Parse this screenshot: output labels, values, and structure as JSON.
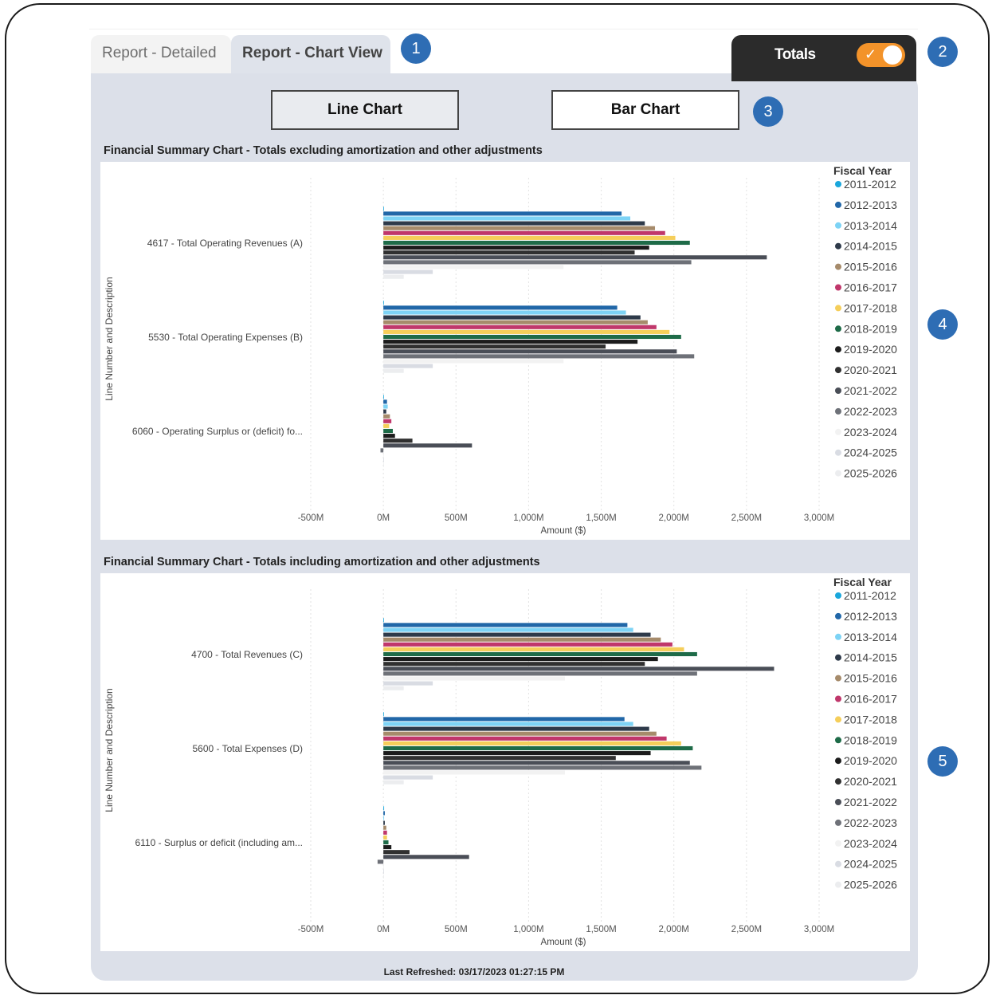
{
  "tabs": [
    {
      "label": "Report - Detailed"
    },
    {
      "label": "Report - Chart View"
    }
  ],
  "totals": {
    "label": "Totals",
    "toggle_on": true,
    "toggle_color": "#F3932A"
  },
  "view_buttons": {
    "line": "Line Chart",
    "bar": "Bar Chart"
  },
  "markers": [
    "1",
    "2",
    "3",
    "4",
    "5"
  ],
  "footer": {
    "last_refreshed": "Last Refreshed: 03/17/2023 01:27:15 PM"
  },
  "chart_data": [
    {
      "type": "bar",
      "orientation": "horizontal",
      "title": "Financial Summary Chart - Totals excluding amortization and other adjustments",
      "xlabel": "Amount ($)",
      "ylabel": "Line Number and Description",
      "xlim": [
        -500,
        3000
      ],
      "xticks": [
        "-500M",
        "0M",
        "500M",
        "1,000M",
        "1,500M",
        "2,000M",
        "2,500M",
        "3,000M"
      ],
      "legend_title": "Fiscal Year",
      "legend_position": "right",
      "categories": [
        "4617 - Total Operating Revenues (A)",
        "5530 - Total Operating Expenses (B)",
        "6060 - Operating Surplus or (deficit) fo..."
      ],
      "series": [
        {
          "name": "2011-2012",
          "color": "#1AA7DC",
          "values": [
            1,
            1,
            1
          ]
        },
        {
          "name": "2012-2013",
          "color": "#2167A8",
          "values": [
            1640,
            1610,
            25
          ]
        },
        {
          "name": "2013-2014",
          "color": "#7DD3F5",
          "values": [
            1700,
            1670,
            30
          ]
        },
        {
          "name": "2014-2015",
          "color": "#2E3A4A",
          "values": [
            1800,
            1770,
            20
          ]
        },
        {
          "name": "2015-2016",
          "color": "#A68B6B",
          "values": [
            1870,
            1820,
            45
          ]
        },
        {
          "name": "2016-2017",
          "color": "#C0376B",
          "values": [
            1940,
            1880,
            55
          ]
        },
        {
          "name": "2017-2018",
          "color": "#F5CE5A",
          "values": [
            2010,
            1970,
            40
          ]
        },
        {
          "name": "2018-2019",
          "color": "#1E6B48",
          "values": [
            2110,
            2050,
            65
          ]
        },
        {
          "name": "2019-2020",
          "color": "#1C1C1C",
          "values": [
            1830,
            1750,
            80
          ]
        },
        {
          "name": "2020-2021",
          "color": "#303030",
          "values": [
            1730,
            1530,
            200
          ]
        },
        {
          "name": "2021-2022",
          "color": "#4A4E57",
          "values": [
            2640,
            2020,
            610
          ]
        },
        {
          "name": "2022-2023",
          "color": "#6E7178",
          "values": [
            2120,
            2140,
            -20
          ]
        },
        {
          "name": "2023-2024",
          "color": "#F2F2F2",
          "values": [
            1240,
            1240,
            0
          ]
        },
        {
          "name": "2024-2025",
          "color": "#D9DCE3",
          "values": [
            340,
            340,
            0
          ]
        },
        {
          "name": "2025-2026",
          "color": "#ECEDEF",
          "values": [
            140,
            140,
            0
          ]
        }
      ]
    },
    {
      "type": "bar",
      "orientation": "horizontal",
      "title": "Financial Summary Chart - Totals including amortization and other adjustments",
      "xlabel": "Amount ($)",
      "ylabel": "Line Number and Description",
      "xlim": [
        -500,
        3000
      ],
      "xticks": [
        "-500M",
        "0M",
        "500M",
        "1,000M",
        "1,500M",
        "2,000M",
        "2,500M",
        "3,000M"
      ],
      "legend_title": "Fiscal Year",
      "legend_position": "right",
      "categories": [
        "4700 - Total Revenues (C)",
        "5600 - Total Expenses (D)",
        "6110 - Surplus or deficit (including am..."
      ],
      "series": [
        {
          "name": "2011-2012",
          "color": "#1AA7DC",
          "values": [
            1,
            1,
            5
          ]
        },
        {
          "name": "2012-2013",
          "color": "#2167A8",
          "values": [
            1680,
            1660,
            10
          ]
        },
        {
          "name": "2013-2014",
          "color": "#7DD3F5",
          "values": [
            1720,
            1720,
            5
          ]
        },
        {
          "name": "2014-2015",
          "color": "#2E3A4A",
          "values": [
            1840,
            1830,
            10
          ]
        },
        {
          "name": "2015-2016",
          "color": "#A68B6B",
          "values": [
            1910,
            1880,
            20
          ]
        },
        {
          "name": "2016-2017",
          "color": "#C0376B",
          "values": [
            1990,
            1950,
            25
          ]
        },
        {
          "name": "2017-2018",
          "color": "#F5CE5A",
          "values": [
            2070,
            2050,
            25
          ]
        },
        {
          "name": "2018-2019",
          "color": "#1E6B48",
          "values": [
            2160,
            2130,
            35
          ]
        },
        {
          "name": "2019-2020",
          "color": "#1C1C1C",
          "values": [
            1890,
            1840,
            55
          ]
        },
        {
          "name": "2020-2021",
          "color": "#303030",
          "values": [
            1800,
            1600,
            180
          ]
        },
        {
          "name": "2021-2022",
          "color": "#4A4E57",
          "values": [
            2690,
            2110,
            590
          ]
        },
        {
          "name": "2022-2023",
          "color": "#6E7178",
          "values": [
            2160,
            2190,
            -40
          ]
        },
        {
          "name": "2023-2024",
          "color": "#F2F2F2",
          "values": [
            1250,
            1250,
            0
          ]
        },
        {
          "name": "2024-2025",
          "color": "#D9DCE3",
          "values": [
            340,
            340,
            0
          ]
        },
        {
          "name": "2025-2026",
          "color": "#ECEDEF",
          "values": [
            140,
            140,
            0
          ]
        }
      ]
    }
  ]
}
